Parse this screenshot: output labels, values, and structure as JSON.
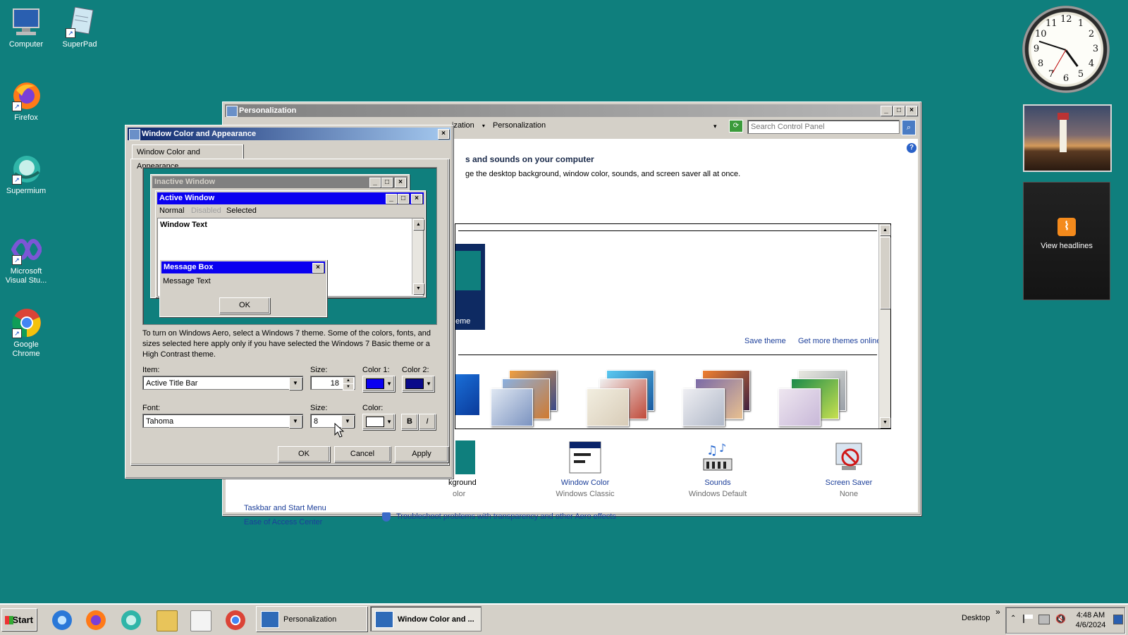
{
  "desktop": {
    "icons": [
      {
        "label": "Computer"
      },
      {
        "label": "SuperPad"
      },
      {
        "label": "Firefox"
      },
      {
        "label": "Supermium"
      },
      {
        "label": "Microsoft Visual Stu..."
      },
      {
        "label": "Google Chrome"
      }
    ]
  },
  "gadgets": {
    "clock_numbers": [
      "12",
      "1",
      "2",
      "3",
      "4",
      "5",
      "6",
      "7",
      "8",
      "9",
      "10",
      "11"
    ],
    "feed_label": "View headlines"
  },
  "personalization": {
    "title": "Personalization",
    "breadcrumb_left": "ization",
    "breadcrumb_current": "Personalization",
    "search_placeholder": "Search Control Panel",
    "heading": "s and sounds on your computer",
    "subheading": "ge the desktop background, window color, sounds, and screen saver all at once.",
    "theme_caption": "eme",
    "save_theme": "Save theme",
    "get_more_themes": "Get more themes online",
    "categories": [
      {
        "label": "kground",
        "sub": "olor"
      },
      {
        "label": "Window Color",
        "sub": "Windows Classic"
      },
      {
        "label": "Sounds",
        "sub": "Windows Default"
      },
      {
        "label": "Screen Saver",
        "sub": "None"
      }
    ],
    "see_also": [
      "Taskbar and Start Menu",
      "Ease of Access Center"
    ],
    "troubleshoot": "Troubleshoot problems with transparency and other Aero effects"
  },
  "wca": {
    "title": "Window Color and Appearance",
    "tab": "Window Color and Appearance",
    "preview": {
      "inactive_title": "Inactive Window",
      "active_title": "Active Window",
      "menu": [
        "Normal",
        "Disabled",
        "Selected"
      ],
      "window_text": "Window Text",
      "msgbox_title": "Message Box",
      "msgbox_text": "Message Text",
      "msgbox_ok": "OK"
    },
    "info": "To turn on Windows Aero, select a Windows 7 theme.  Some of the colors, fonts, and sizes selected here apply only if you have selected the Windows 7 Basic theme or a High Contrast theme.",
    "item_label": "Item:",
    "item_value": "Active Title Bar",
    "item_size_label": "Size:",
    "item_size_value": "18",
    "color1_label": "Color 1:",
    "color2_label": "Color 2:",
    "color1": "#0a00f0",
    "color2": "#0a0a8a",
    "font_label": "Font:",
    "font_value": "Tahoma",
    "font_size_label": "Size:",
    "font_size_value": "8",
    "font_color_label": "Color:",
    "font_color": "#ffffff",
    "bold": "B",
    "italic": "I",
    "ok": "OK",
    "cancel": "Cancel",
    "apply": "Apply"
  },
  "taskbar": {
    "start": "Start",
    "tasks": [
      {
        "label": "Personalization"
      },
      {
        "label": "Window Color and ..."
      }
    ],
    "toolbar_label": "Desktop",
    "chevron": "»",
    "time": "4:48 AM",
    "date": "4/6/2024"
  },
  "colors": {
    "desktop": "#0f7f7d",
    "active_title": "#0a246a",
    "preview_active_title": "#0a00f0",
    "link": "#1c3f9a"
  }
}
